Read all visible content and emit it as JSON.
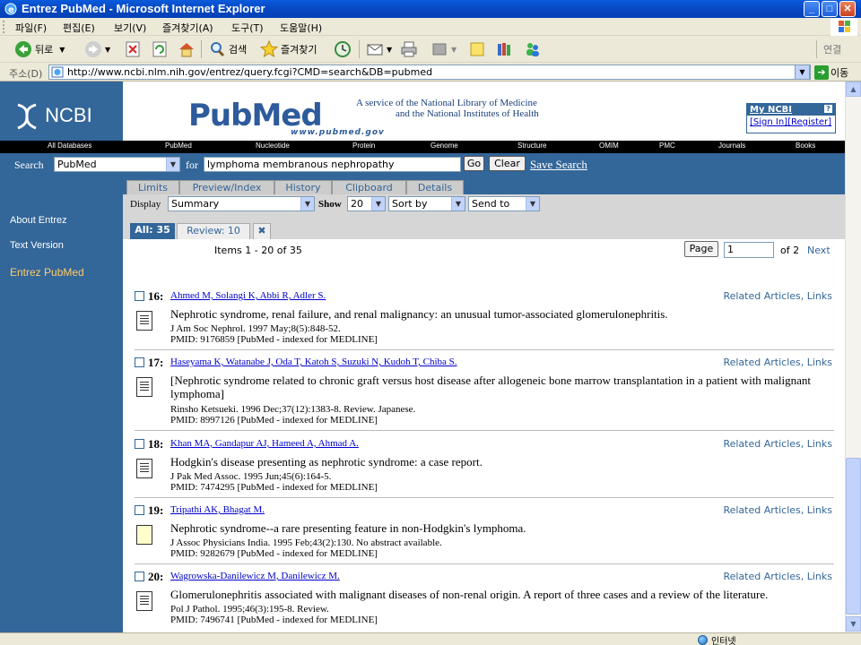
{
  "window": {
    "title": "Entrez PubMed - Microsoft Internet Explorer",
    "minimize": "_",
    "maximize": "□",
    "close": "✕"
  },
  "menu": [
    "파일(F)",
    "편집(E)",
    "보기(V)",
    "즐겨찾기(A)",
    "도구(T)",
    "도움말(H)"
  ],
  "toolbar": {
    "back_label": "뒤로",
    "search_label": "검색",
    "favorites_label": "즐겨찾기",
    "links_label": "연결"
  },
  "address": {
    "label": "주소(D)",
    "url": "http://www.ncbi.nlm.nih.gov/entrez/query.fcgi?CMD=search&DB=pubmed",
    "go_label": "이동"
  },
  "ncbi": {
    "logo": "NCBI",
    "pubmed_logo": "PubMed",
    "pubmed_url": "www.pubmed.gov",
    "service_line1": "A service of the National Library of Medicine",
    "service_line2": "and the National Institutes of Health",
    "myncbi_title": "My NCBI",
    "myncbi_help": "?",
    "sign_in": "[Sign In]",
    "register": "[Register]"
  },
  "nav_tabs": [
    "All Databases",
    "PubMed",
    "Nucleotide",
    "Protein",
    "Genome",
    "Structure",
    "OMIM",
    "PMC",
    "Journals",
    "Books"
  ],
  "search": {
    "label": "Search",
    "database": "PubMed",
    "for_label": "for",
    "query": "lymphoma membranous nephropathy",
    "go_button": "Go",
    "clear_button": "Clear",
    "save_link": "Save Search"
  },
  "sidebar": {
    "items": [
      "About Entrez",
      "Text Version",
      "Entrez PubMed"
    ]
  },
  "feature_tabs": [
    "Limits",
    "Preview/Index",
    "History",
    "Clipboard",
    "Details"
  ],
  "display": {
    "display_label": "Display",
    "display_value": "Summary",
    "show_label": "Show",
    "show_value": "20",
    "sort_value": "Sort by",
    "send_value": "Send to"
  },
  "result_tabs": {
    "all": "All: 35",
    "review": "Review: 10"
  },
  "paging": {
    "items_text": "Items 1 - 20 of 35",
    "page_button": "Page",
    "page_value": "1",
    "of_pages": "of 2",
    "next": "Next"
  },
  "results": [
    {
      "num": "16:",
      "authors": "Ahmed M, Solangi K, Abbi R, Adler S.",
      "related": "Related Articles, Links",
      "title": "Nephrotic syndrome, renal failure, and renal malignancy: an unusual tumor-associated glomerulonephritis.",
      "citation": "J Am Soc Nephrol. 1997 May;8(5):848-52.",
      "pmid": "PMID: 9176859 [PubMed - indexed for MEDLINE]",
      "has_abstract": true
    },
    {
      "num": "17:",
      "authors": "Haseyama K, Watanabe J, Oda T, Katoh S, Suzuki N, Kudoh T, Chiba S.",
      "related": "Related Articles, Links",
      "title": "[Nephrotic syndrome related to chronic graft versus host disease after allogeneic bone marrow transplantation in a patient with malignant lymphoma]",
      "citation": "Rinsho Ketsueki. 1996 Dec;37(12):1383-8. Review. Japanese.",
      "pmid": "PMID: 8997126 [PubMed - indexed for MEDLINE]",
      "has_abstract": true
    },
    {
      "num": "18:",
      "authors": "Khan MA, Gandapur AJ, Hameed A, Ahmad A.",
      "related": "Related Articles, Links",
      "title": "Hodgkin's disease presenting as nephrotic syndrome: a case report.",
      "citation": "J Pak Med Assoc. 1995 Jun;45(6):164-5.",
      "pmid": "PMID: 7474295 [PubMed - indexed for MEDLINE]",
      "has_abstract": true
    },
    {
      "num": "19:",
      "authors": "Tripathi AK, Bhagat M.",
      "related": "Related Articles, Links",
      "title": "Nephrotic syndrome--a rare presenting feature in non-Hodgkin's lymphoma.",
      "citation": "J Assoc Physicians India. 1995 Feb;43(2):130. No abstract available.",
      "pmid": "PMID: 9282679 [PubMed - indexed for MEDLINE]",
      "has_abstract": false
    },
    {
      "num": "20:",
      "authors": "Wagrowska-Danilewicz M, Danilewicz M.",
      "related": "Related Articles, Links",
      "title": "Glomerulonephritis associated with malignant diseases of non-renal origin. A report of three cases and a review of the literature.",
      "citation": "Pol J Pathol. 1995;46(3):195-8. Review.",
      "pmid": "PMID: 7496741 [PubMed - indexed for MEDLINE]",
      "has_abstract": true
    }
  ],
  "status": {
    "zone": "인터넷"
  }
}
